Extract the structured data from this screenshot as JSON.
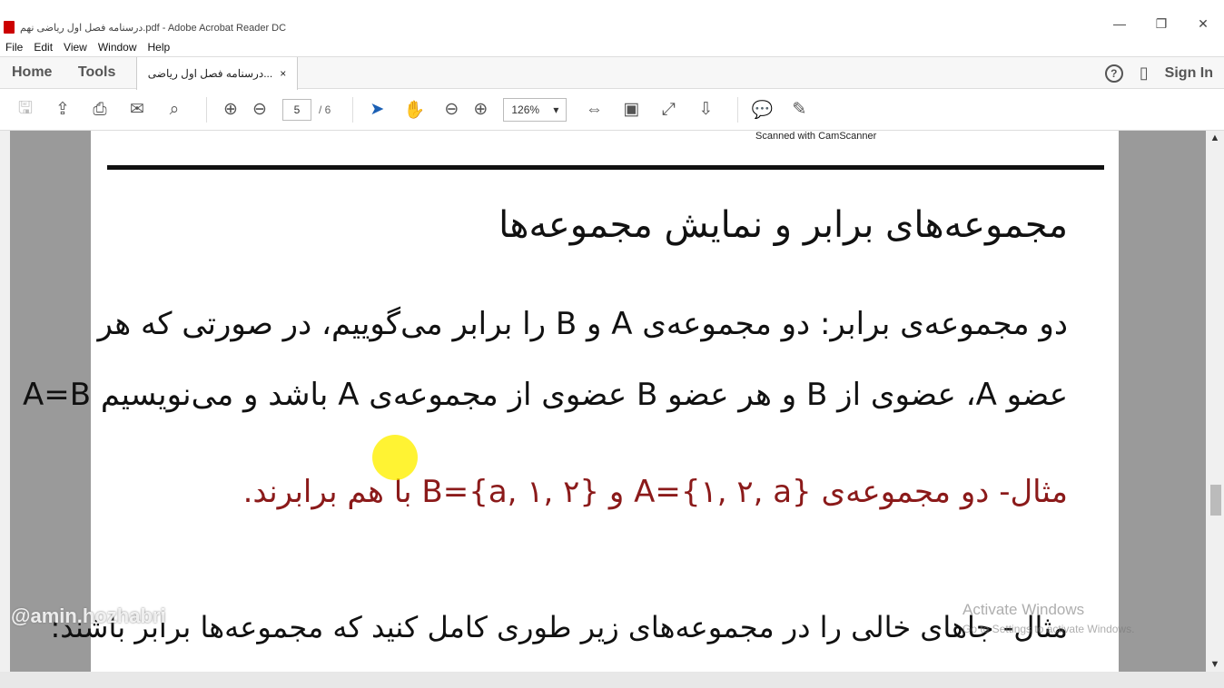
{
  "window": {
    "title": "درسنامه فصل اول ریاضی نهم.pdf - Adobe Acrobat Reader DC",
    "minimize": "—",
    "restore": "❐",
    "close": "✕"
  },
  "menu": [
    "File",
    "Edit",
    "View",
    "Window",
    "Help"
  ],
  "tabs": {
    "home": "Home",
    "tools": "Tools",
    "doc_tab": "درسنامه فصل اول ریاضی...",
    "close": "×"
  },
  "header_right": {
    "help": "?",
    "sign_in": "Sign In"
  },
  "toolbar": {
    "page_current": "5",
    "page_total": "/ 6",
    "zoom": "126%"
  },
  "document": {
    "banner": "Scanned with CamScanner",
    "heading": "مجموعه‌های برابر و نمایش مجموعه‌ها",
    "line1": "دو مجموعه‌ی برابر: دو مجموعه‌ی A و B را برابر می‌گوییم، در صورتی که هر",
    "line2": "عضو A، عضوی از B و هر عضو B عضوی از مجموعه‌ی A باشد و می‌نویسیم A=B",
    "example1": "مثال- دو مجموعه‌ی A={۱, ۲, a} و B={a, ۱, ۲} با هم برابرند.",
    "example2": "مثال- جاهای خالی را در مجموعه‌های زیر طوری کامل کنید که مجموعه‌ها برابر باشند:"
  },
  "overlay": {
    "watermark": "@amin.hozhabri",
    "activate_title": "Activate Windows",
    "activate_sub": "Go to Settings to activate Windows."
  }
}
